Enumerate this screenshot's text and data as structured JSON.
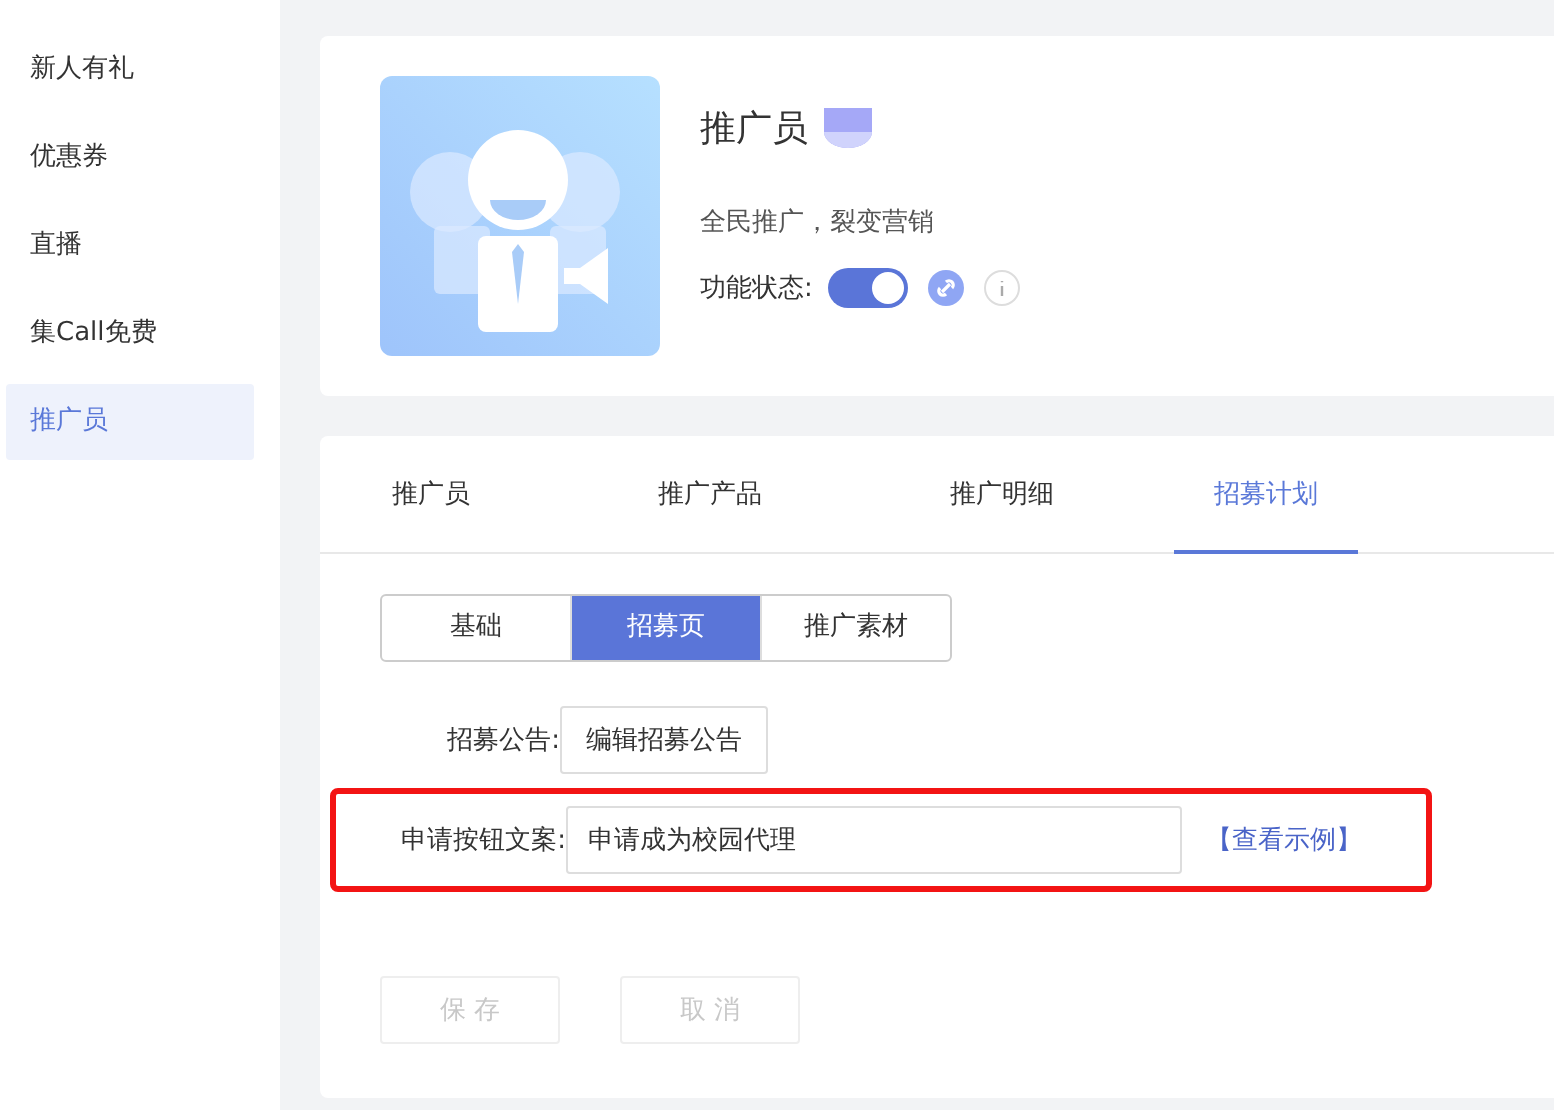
{
  "sidebar": {
    "items": [
      {
        "label": "新人有礼",
        "selected": false
      },
      {
        "label": "优惠券",
        "selected": false
      },
      {
        "label": "直播",
        "selected": false
      },
      {
        "label": "集Call免费",
        "selected": false
      },
      {
        "label": "推广员",
        "selected": true
      }
    ]
  },
  "header": {
    "title": "推广员",
    "description": "全民推广，裂变营销",
    "status_label": "功能状态:",
    "status_on": true
  },
  "tabs": [
    {
      "label": "推广员",
      "selected": false
    },
    {
      "label": "推广产品",
      "selected": false
    },
    {
      "label": "推广明细",
      "selected": false
    },
    {
      "label": "招募计划",
      "selected": true
    }
  ],
  "segments": [
    {
      "label": "基础",
      "selected": false
    },
    {
      "label": "招募页",
      "selected": true
    },
    {
      "label": "推广素材",
      "selected": false
    }
  ],
  "form": {
    "notice_label": "招募公告:",
    "notice_button": "编辑招募公告",
    "apply_label": "申请按钮文案:",
    "apply_value": "申请成为校园代理",
    "example_link": "【查看示例】",
    "highlighted": true
  },
  "actions": [
    {
      "label": "保 存",
      "disabled": true
    },
    {
      "label": "取 消",
      "disabled": true
    }
  ]
}
